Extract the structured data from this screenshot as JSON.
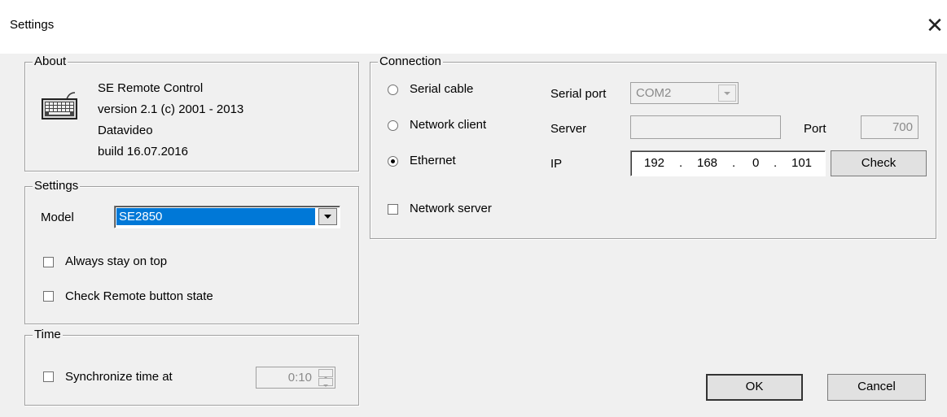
{
  "window": {
    "title": "Settings",
    "close_glyph": "✕"
  },
  "about": {
    "legend": "About",
    "app_name": "SE Remote Control",
    "version": "version 2.1  (c) 2001 - 2013",
    "company": "Datavideo",
    "build": "build  16.07.2016",
    "icon": "keyboard-icon"
  },
  "settings": {
    "legend": "Settings",
    "model_label": "Model",
    "model_value": "SE2850",
    "always_on_top_label": "Always stay on top",
    "always_on_top_checked": false,
    "check_remote_label": "Check Remote button state",
    "check_remote_checked": false
  },
  "time": {
    "legend": "Time",
    "sync_label": "Synchronize time at",
    "sync_checked": false,
    "time_value": "0:10"
  },
  "connection": {
    "legend": "Connection",
    "serial_cable_label": "Serial cable",
    "network_client_label": "Network client",
    "ethernet_label": "Ethernet",
    "selected": "Ethernet",
    "serial_port_label": "Serial port",
    "serial_port_value": "COM2",
    "server_label": "Server",
    "server_value": "",
    "port_label": "Port",
    "port_value": "700",
    "ip_label": "IP",
    "ip": [
      "192",
      "168",
      "0",
      "101"
    ],
    "ip_sep": ".",
    "check_label": "Check",
    "network_server_label": "Network server",
    "network_server_checked": false
  },
  "buttons": {
    "ok_label": "OK",
    "cancel_label": "Cancel"
  }
}
